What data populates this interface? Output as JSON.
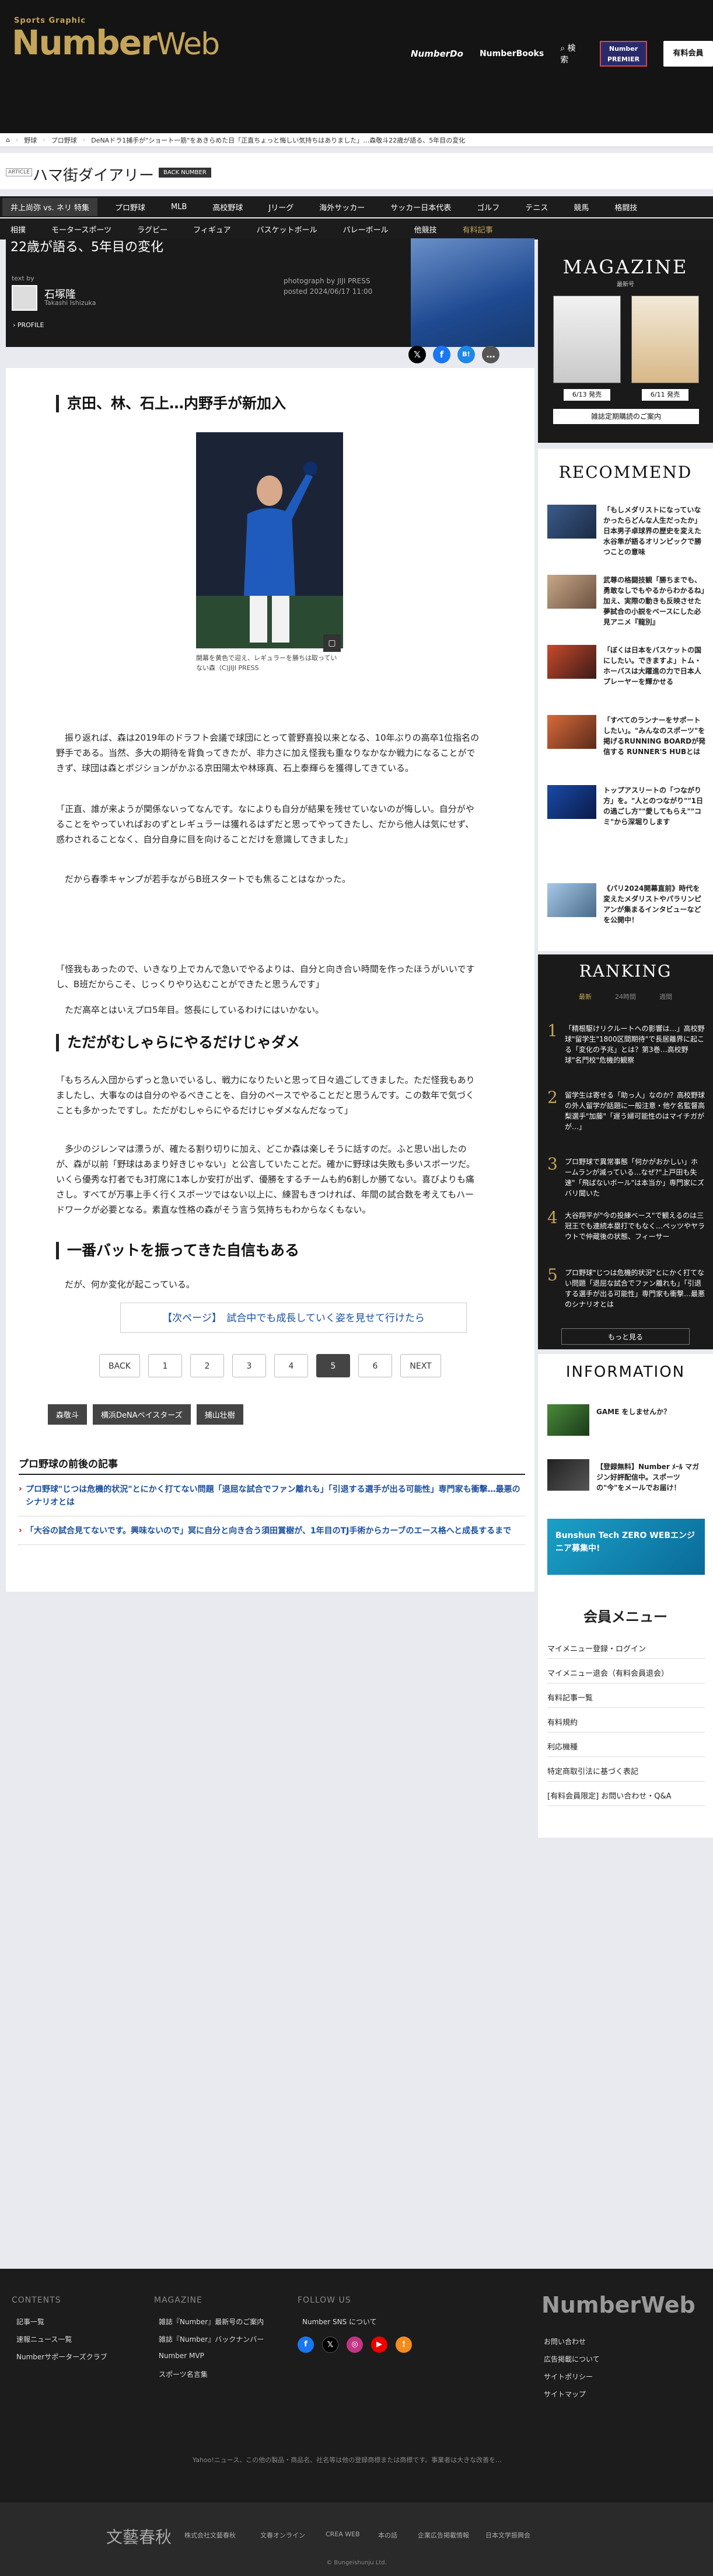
{
  "header": {
    "brand_top": "Sports Graphic",
    "brand_number": "Number",
    "brand_web": "Web",
    "nav_do": "NumberDo",
    "nav_books": "NumberBooks",
    "nav_search": "検索",
    "premier": "Number PREMIER",
    "signup": "有料会員"
  },
  "breadcrumb": [
    "野球",
    "プロ野球",
    "DeNAドラ1捕手が\"ショート一筋\"をあきらめた日「正直ちょっと悔しい気持ちはありました」…森敬斗22歳が語る、5年目の変化"
  ],
  "column": {
    "article_tag": "ARTICLE",
    "title": "ハマ街ダイアリー",
    "back": "BACK NUMBER"
  },
  "nav1": [
    "井上尚弥 vs. ネリ 特集",
    "プロ野球",
    "MLB",
    "高校野球",
    "Jリーグ",
    "海外サッカー",
    "サッカー日本代表",
    "ゴルフ",
    "テニス",
    "競馬",
    "格闘技"
  ],
  "nav2": [
    "相撲",
    "モータースポーツ",
    "ラグビー",
    "フィギュア",
    "バスケットボール",
    "バレーボール",
    "他競技",
    "有料記事"
  ],
  "hero": {
    "title": "22歳が語る、5年目の変化",
    "text_by": "text by",
    "author": "石塚隆",
    "author_roman": "Takashi Ishizuka",
    "profile": "PROFILE",
    "photo_by": "photograph by  JIJI PRESS",
    "posted": "posted  2024/06/17 11:00"
  },
  "share": [
    "𝕏",
    "f",
    "B!",
    "…"
  ],
  "article": {
    "h1": "京田、林、石上…内野手が新加入",
    "caption": "開幕を黄色で迎え、レギュラーを勝ちは取っていない森（C)JIJI PRESS",
    "p1": "振り返れば、森は2019年のドラフト会議で球団にとって菅野喜投以来となる、10年ぶりの高卒1位指名の野手である。当然、多大の期待を背負ってきたが、非力さに加え怪我も重なりなかなか戦力になることができず、球団は森とポジションがかぶる京田陽太や林琢真、石上泰輝らを獲得してきている。",
    "p2": "「正直、誰が来ようが関係ないってなんです。なによりも自分が結果を残せていないのが悔しい。自分がやることをやっていればおのずとレギュラーは獲れるはずだと思ってやってきたし、だから他人は気にせず、惑わされることなく、自分自身に目を向けることだけを意識してきました」",
    "p3": "だから春季キャンプが若手ながらB班スタートでも焦ることはなかった。",
    "p4": "「怪我もあったので、いきなり上でカんで急いでやるよりは、自分と向き合い時間を作ったほうがいいです し、B班だからこそ、じっくりやり込むことができたと思うんです」",
    "p5": "ただ高卒とはいえプロ5年目。悠長にしているわけにはいかない。",
    "h2": "ただがむしゃらにやるだけじゃダメ",
    "p6": "「もちろん入団からずっと急いでいるし、戦力になりたいと思って日々過ごしてきました。ただ怪我もありましたし、大事なのは自分のやるべきことを、自分のペースでやることだと思うんです。この数年で気づくことも多かったですし。ただがむしゃらにやるだけじゃダメなんだなって」",
    "p7": "多少のジレンマは漂うが、確たる割り切りに加え、どこか森は楽しそうに話すのだ。ふと思い出したのが、森が以前「野球はあまり好きじゃない」と公言していたことだ。確かに野球は失敗も多いスポーツだ。いくら優秀な打者でも3打席に1本しか安打が出ず、優勝をするチームも約6割しか勝てない。喜びよりも痛さし。すべてが万事上手く行くスポーツではない以上に、練習もきつければ、年間の試合数を考えてもハードワークが必要となる。素直な性格の森がそう言う気持ちもわからなくもない。",
    "h3": "一番バットを振ってきた自信もある",
    "p8": "だが、何か変化が起こっている。",
    "next": "【次ページ】　試合中でも成長していく姿を見せて行けたら"
  },
  "pager": [
    "BACK",
    "1",
    "2",
    "3",
    "4",
    "5",
    "6",
    "NEXT"
  ],
  "tags": [
    "森敬斗",
    "横浜DeNAベイスターズ",
    "捕山壮樹"
  ],
  "related": {
    "heading": "プロ野球の前後の記事",
    "items": [
      "プロ野球\"じつは危機的状況\"とにかく打てない問題「退屈な試合でファン離れも」「引退する選手が出る可能性」専門家も衝撃…最悪のシナリオとは",
      "「大谷の試合見てないです。興味ないので」冥に自分と向き合う須田賞樹が、1年目のTJ手術からカーブのエース格へと成長するまで"
    ]
  },
  "magazine": {
    "title": "MAGAZINE",
    "sub": "最新号",
    "date1": "6/13 発売",
    "date2": "6/11 発売",
    "subscribe": "雑誌定期購読のご案内"
  },
  "recommend": {
    "heading": "RECOMMEND",
    "items": [
      "「もしメダリストになっていなかったらどんな人生だったか」日本男子卓球界の歴史を変えた水谷隼が語るオリンピックで勝つことの意味",
      "武尊の格闘技観「勝ちまでも、勇敢なしでもやるからわかるね」加え、実際の動きも反映させた夢試合の小説をベースにした必見アニメ『龍別』",
      "「ぼくは日本をバスケットの国にしたい。できますよ」トム・ホーバスは大躍進の力で日本人プレーヤーを輝かせる",
      "「すべてのランナーをサポートしたい」。\"みんなのスポーツ\"を掲げるRUNNING BOARDが発信する RUNNER'S HUBとは",
      "トップアスリートの「つながり方」を。\"人とのつながり\"\"1日の過ごし方\"\"愛してもらえ\"\"コミ\"から深堀りします",
      "《パリ2024開幕直前》時代を変えたメダリストやパラリンピアンが集まるインタビューなどを公開中！"
    ]
  },
  "ranking": {
    "heading": "RANKING",
    "tabs": [
      "最新",
      "24時間",
      "週間"
    ],
    "items": [
      "「精根駆けリクルートへの影響は…」高校野球\"留学生\"1800区間期待\"で長居離界に起こる「変化の予兆」とは？第3巻…高校野球\"名門校\"危機的観察",
      "留学生は寄せる「助っ人」なのか？高校野球の外人留学が話題に一般注意・他ケ名監督高梨選手\"加藤\"「遅う婦可能性のはマイチガがが…」",
      "プロ野球で異常事態「何かがおかしい」ホームランが減っている…なぜ?\"上戸田も失速\"「飛ばないボール\"は本当か」専門家にズバリ聞いた",
      "大谷翔平が\"今の投練ベース\"で観えるのは三冠王でも連続本塁打でもなく…ペッツやヤラウトで仲蔵後の状態、フィーサー",
      "プロ野球\"じつは危機的状況\"とにかく打てない問題「退屈な試合でファン離れも」「引退する選手が出る可能性」専門家も衝撃…最悪のシナリオとは"
    ],
    "more": "もっと見る"
  },
  "information": {
    "heading": "INFORMATION",
    "items": [
      "GAME をしませんか？",
      "【登録無料】Number ﾒｰﾙ マガジン好評配信中。スポーツの\"今\"をメールでお届け！",
      "Bunshun Tech ZERO WEBエンジニア募集中!"
    ]
  },
  "member": {
    "heading": "会員メニュー",
    "items": [
      "マイメニュー登録・ログイン",
      "マイメニュー退会（有料会員退会）",
      "有料記事一覧",
      "有料規約",
      "利応機種",
      "特定商取引法に基づく表記",
      "[有料会員限定] お問い合わせ・Q&A"
    ]
  },
  "footer": {
    "contents_h": "CONTENTS",
    "contents": [
      "記事一覧",
      "速報ニュース一覧",
      "Numberサポーターズクラブ"
    ],
    "magazine_h": "MAGAZINE",
    "magazine": [
      "雑誌『Number』最新号のご案内",
      "雑誌『Number』バックナンバー",
      "Number MVP",
      "スポーツ名言集"
    ],
    "follow_h": "FOLLOW US",
    "follow": [
      "Number SNS について"
    ],
    "logo": "NumberWeb",
    "right": [
      "お問い合わせ",
      "広告掲載について",
      "サイトポリシー",
      "サイトマップ"
    ],
    "disclaimer": "Yahoo!ニュース、この他の製品・商品名、社名等は他の登録商標または商標です。事業者は大きな改善を…",
    "publisher": "文藝春秋",
    "bottom_links": [
      "株式会社文藝春秋",
      "文春オンライン",
      "CREA WEB",
      "本の話",
      "企業広告掲載情報",
      "日本文学振興会"
    ],
    "copyright": "© Bungeishunju Ltd."
  }
}
